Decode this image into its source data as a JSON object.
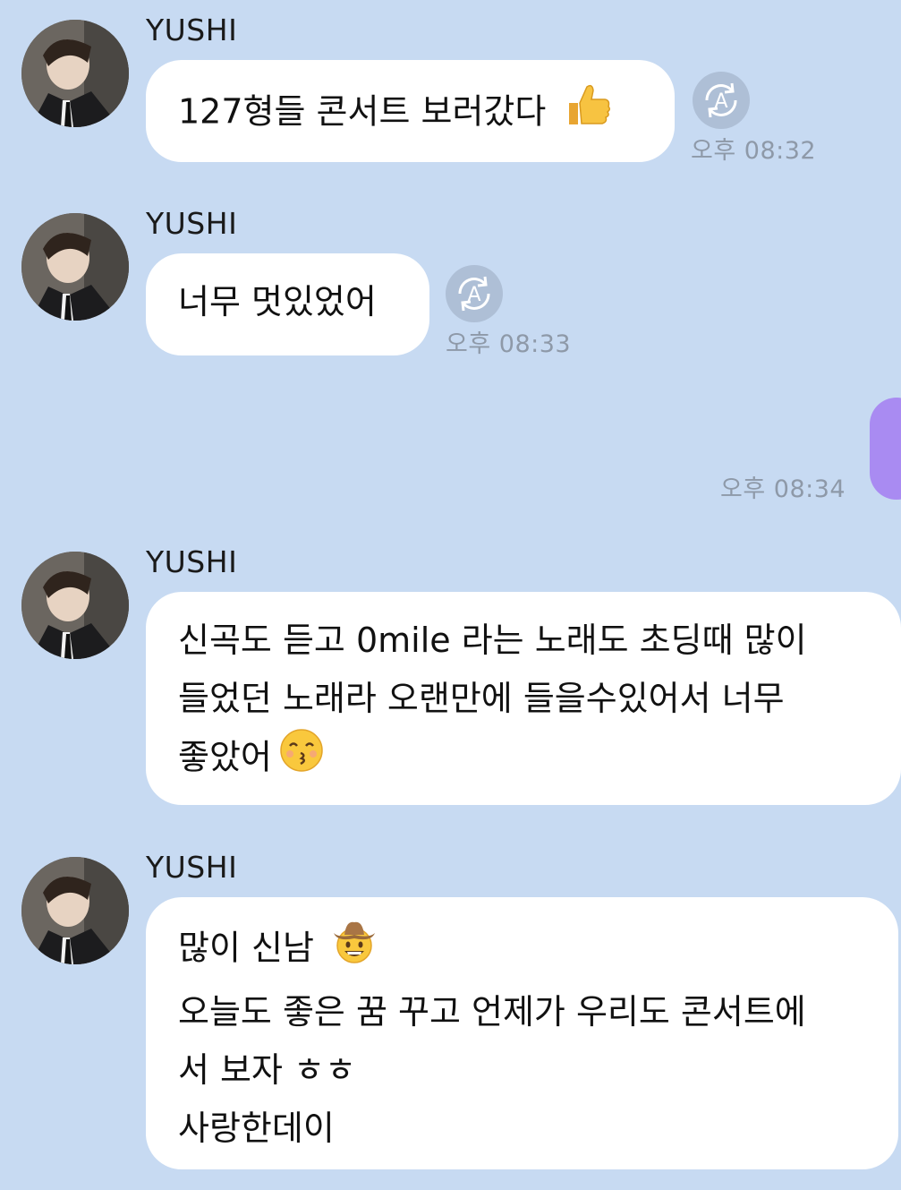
{
  "conversation": {
    "messages": [
      {
        "sender": "YUSHI",
        "lines": [
          "127형들 콘서트 보러갔다"
        ],
        "emoji": "thumbs-up",
        "time": "오후 08:32",
        "translate_label": "A"
      },
      {
        "sender": "YUSHI",
        "lines": [
          "너무 멋있었어"
        ],
        "time": "오후 08:33",
        "translate_label": "A"
      },
      {
        "outgoing": true,
        "time": "오후 08:34"
      },
      {
        "sender": "YUSHI",
        "lines": [
          "신곡도 듣고 0mile 라는 노래도 초딩때 많이",
          "들었던 노래라 오랜만에 들을수있어서 너무",
          "좋았어"
        ],
        "emoji": "kissing-face"
      },
      {
        "sender": "YUSHI",
        "lines": [
          "많이 신남",
          "오늘도 좋은 꿈 꾸고 언제가 우리도 콘서트에",
          "서 보자 ㅎㅎ",
          "사랑한데이"
        ],
        "emoji": "cowboy-face"
      }
    ]
  },
  "colors": {
    "background": "#c7daf2",
    "bubble_in": "#ffffff",
    "bubble_out": "#a98bf2",
    "timestamp": "#8e99a8"
  }
}
